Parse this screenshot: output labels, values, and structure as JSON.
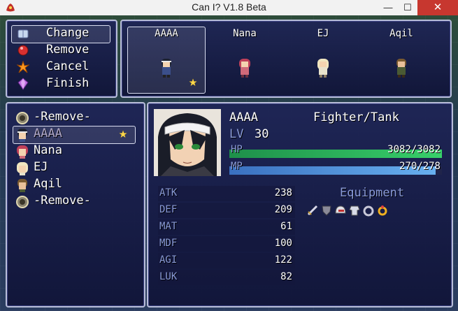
{
  "window": {
    "title": "Can I? V1.8 Beta",
    "min": "—",
    "max": "☐",
    "close": "✕"
  },
  "commands": [
    {
      "label": "Change",
      "icon": "book-icon",
      "color": "#c8d8f0"
    },
    {
      "label": "Remove",
      "icon": "red-orb-icon",
      "color": "#d83030"
    },
    {
      "label": "Cancel",
      "icon": "burst-icon",
      "color": "#ff9a20"
    },
    {
      "label": "Finish",
      "icon": "purple-gem-icon",
      "color": "#c070e0"
    }
  ],
  "party": [
    {
      "name": "AAAA",
      "leader": true,
      "hair": "#1d2230",
      "outfit": "#3b4f8a"
    },
    {
      "name": "Nana",
      "leader": false,
      "hair": "#c0405a",
      "outfit": "#d06a7a"
    },
    {
      "name": "EJ",
      "leader": false,
      "hair": "#f0e6c0",
      "outfit": "#e8e2cc"
    },
    {
      "name": "Aqil",
      "leader": false,
      "hair": "#7a5a30",
      "outfit": "#4a5a34"
    }
  ],
  "roster": [
    {
      "label": "-Remove-",
      "icon": "orb-icon",
      "highlight": false
    },
    {
      "label": "AAAA",
      "icon": "face-icon",
      "highlight": true,
      "star": true
    },
    {
      "label": "Nana",
      "icon": "face-icon",
      "highlight": false
    },
    {
      "label": "EJ",
      "icon": "face-icon",
      "highlight": false
    },
    {
      "label": "Aqil",
      "icon": "face-icon",
      "highlight": false
    },
    {
      "label": "-Remove-",
      "icon": "orb-icon",
      "highlight": false
    }
  ],
  "status": {
    "name": "AAAA",
    "class": "Fighter/Tank",
    "level_label": "LV",
    "level": "30",
    "hp_label": "HP",
    "hp_text": "3082/3082",
    "hp_fraction": 1.0,
    "mp_label": "MP",
    "mp_text": "270/278",
    "mp_fraction": 0.97,
    "equipment_title": "Equipment",
    "stats": [
      {
        "key": "ATK",
        "value": "238"
      },
      {
        "key": "DEF",
        "value": "209"
      },
      {
        "key": "MAT",
        "value": "61"
      },
      {
        "key": "MDF",
        "value": "100"
      },
      {
        "key": "AGI",
        "value": "122"
      },
      {
        "key": "LUK",
        "value": "82"
      }
    ],
    "equipment": [
      "sword-icon",
      "shield-icon",
      "helmet-icon",
      "armor-icon",
      "ring-icon",
      "gold-ring-icon"
    ]
  }
}
